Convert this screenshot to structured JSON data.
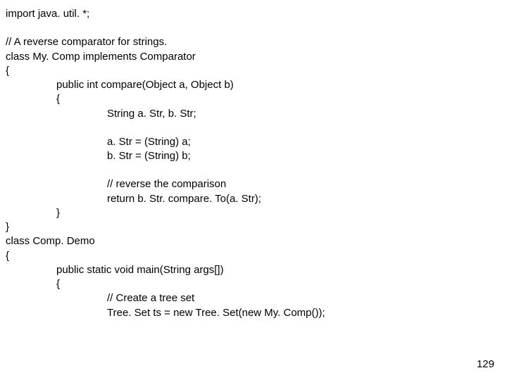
{
  "code": {
    "l1": "import java. util. *;",
    "l2": "// A reverse comparator for strings.",
    "l3": "class My. Comp implements Comparator",
    "l4": "{",
    "l5": "public int compare(Object a, Object b)",
    "l6": "{",
    "l7": "String a. Str, b. Str;",
    "l8": "a. Str = (String) a;",
    "l9": "b. Str = (String) b;",
    "l10": "// reverse the comparison",
    "l11": "return b. Str. compare. To(a. Str);",
    "l12": "}",
    "l13": "}",
    "l14": "class Comp. Demo",
    "l15": "{",
    "l16": "public static void main(String args[])",
    "l17": "{",
    "l18": "// Create a tree set",
    "l19": "Tree. Set ts = new Tree. Set(new My. Comp());"
  },
  "page_number": "129"
}
